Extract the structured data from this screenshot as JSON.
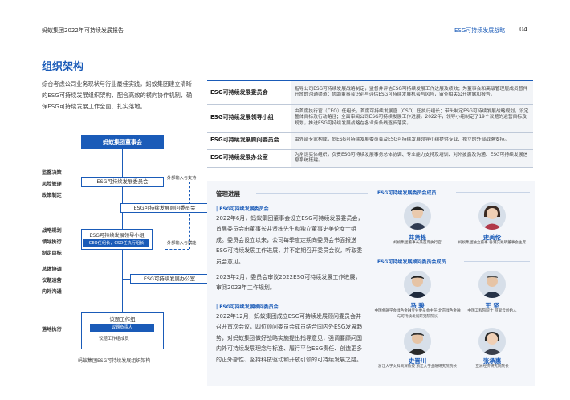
{
  "header": {
    "left": "蚂蚁集团2022年可持续发展报告",
    "right": "ESG可持续发展战略",
    "page": "04"
  },
  "section_title": "组织架构",
  "intro": "综合考虑公司业务现状与行业最佳实践，蚂蚁集团建立清晰的ESG可持续发展组织架构，配合高效的横向协作机制，确保ESG可持续发展工作全面、扎实落地。",
  "org_chart": {
    "top": "蚂蚁集团董事会",
    "committee": "ESG可持续发展委员会",
    "advisory": "ESG可持续发展顾问委员会",
    "leading_group": "ESG可持续发展领导小组",
    "leading_group_sub": "CEO任组长，CSO任执行组长",
    "office": "ESG可持续发展办公室",
    "workstation": "议题工作组",
    "workstation_lead": "议题负责人",
    "workstation_members": "议题工作组成员",
    "arrow_support": "外部输入与支持",
    "arrow_support2": "外部输入与赋能",
    "left_labels_1": [
      "监督决策",
      "风险管理",
      "政策制定"
    ],
    "left_labels_2": [
      "战略规划",
      "领导执行",
      "制定目标"
    ],
    "left_labels_3": [
      "总体协调",
      "议题运营",
      "内外沟通"
    ],
    "left_labels_4": [
      "落地执行"
    ],
    "caption": "蚂蚁集团ESG可持续发展组织架构"
  },
  "governance_table": [
    {
      "name": "ESG可持续发展委员会",
      "desc": "指导公司ESG可持续发展战略制定，监督并评估ESG可持续发展工作进展及绩效；为董事会和高级管理层成员督件开放的沟通渠道；协助董事会识别与评估ESG可持续发展机会与风险，审查相关公开披露和报告。"
    },
    {
      "name": "ESG可持续发展领导小组",
      "desc": "由首席执行官（CEO）任组长，首席可持续发展官（CSO）任执行组长；带头制定ESG可持续发展战略规划，设定整体目标及行动路径；全面审阅公司ESG可持续发展工作进展。2022年，领导小组制定了19个议题的运营目标及规划，推进ESG可持续发展战略在各业务条线逐步落实。"
    },
    {
      "name": "ESG可持续发展顾问委员会",
      "desc": "由外部专家构成，向ESG可持续发展委员会及ESG可持续发展领导小组提供专业、独立的外部战略支持。"
    },
    {
      "name": "ESG可持续发展办公室",
      "desc": "为常设实体组织，负责ESG可持续发展事务总体协调、专业能力支持及培训、对外披露及沟通、ESG可持续发展信息系统搭建。"
    }
  ],
  "progress": {
    "title": "管理进展",
    "sub1": "ESG可持续发展委员会",
    "para1": "2022年6月，蚂蚁集团董事会设立ESG可持续发展委员会，首届委员会由董事长井贤栋先生和独立董事史美伦女士组成。委员会设立以来，公司每季度定期向委员会书面报送ESG可持续发展工作进展，并不定期召开委员会议，听取委员会意见。",
    "para2": "2023年2月，委员会审议2022ESG可持续发展工作进展，审阅2023年工作规划。",
    "sub2": "ESG可持续发展顾问委员会",
    "para3": "2022年12月，蚂蚁集团成立ESG可持续发展顾问委员会并召开首次会议，四位顾问委员会成员结合国内外ESG发展趋势，对蚂蚁集团做好战略实施提出指导意见，强调要顾问国内外可持续发展理念与标准、履行平台ESG责任、创造更多的正外部性、坚持科技驱动和开放引领的可持续发展之路。"
  },
  "members": {
    "committee_head": "ESG可持续发展委员会成员",
    "committee": [
      {
        "name": "井贤栋",
        "role": "蚂蚁集团董事长兼首席执行官"
      },
      {
        "name": "史美伦",
        "role": "蚂蚁集团独立董事 香港交易所董事会主席"
      }
    ],
    "advisory_head": "ESG可持续发展顾问委员会成员",
    "advisory": [
      {
        "name": "马 骏",
        "role": "中国金融学会绿色金融专业委员会主任 北京绿色金融与可持续发展研究院院长"
      },
      {
        "name": "王 坚",
        "role": "中国工程院院士 阿里云创始人"
      },
      {
        "name": "史晋川",
        "role": "浙江大学文科资深教授 浙江大学金融研究院院长"
      },
      {
        "name": "张承惠",
        "role": "亚洲经济研究院院长"
      }
    ]
  },
  "colors": {
    "accent": "#1a5bb8",
    "panel": "#f4f6fa"
  }
}
